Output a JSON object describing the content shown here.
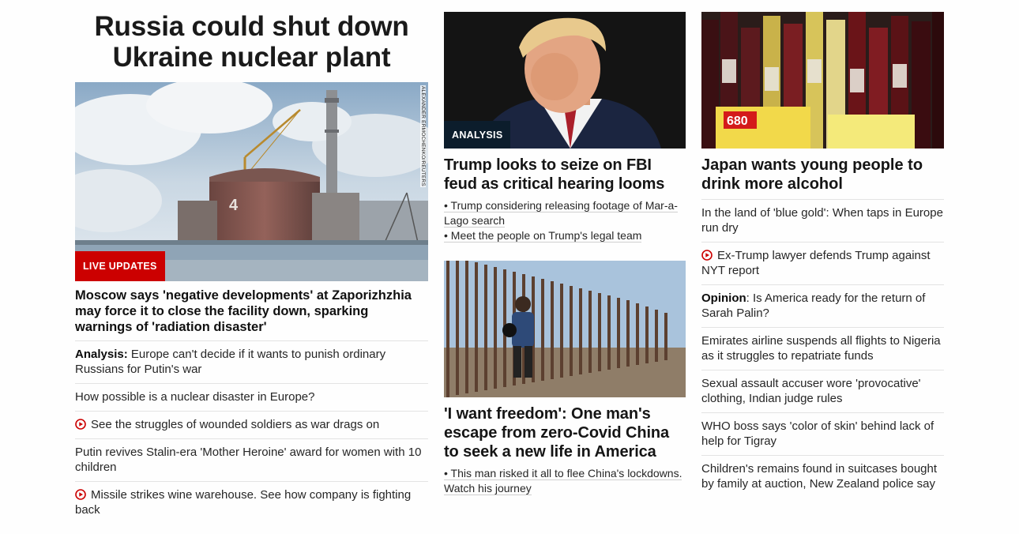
{
  "left": {
    "headline": "Russia could shut down Ukraine nuclear plant",
    "photo_credit": "ALEXANDER ERMOCHENKO/REUTERS",
    "image_label": "LIVE UPDATES",
    "summary": "Moscow says 'negative developments' at Zaporizhzhia may force it to close the facility down, sparking warnings of 'radiation disaster'",
    "items": [
      {
        "prefix": "Analysis:",
        "text": " Europe can't decide if it wants to punish ordinary Russians for Putin's war"
      },
      {
        "text": "How possible is a nuclear disaster in Europe?"
      },
      {
        "text": "See the struggles of wounded soldiers as war drags on",
        "video": true
      },
      {
        "text": "Putin revives Stalin-era 'Mother Heroine' award for women with 10 children"
      },
      {
        "text": "Missile strikes wine warehouse. See how company is fighting back",
        "video": true
      }
    ]
  },
  "mid": {
    "story1": {
      "image_label": "ANALYSIS",
      "headline": "Trump looks to seize on FBI feud as critical hearing looms",
      "bullets": [
        "Trump considering releasing footage of Mar-a-Lago search",
        "Meet the people on Trump's legal team"
      ]
    },
    "story2": {
      "headline": "'I want freedom': One man's escape from zero-Covid China to seek a new life in America",
      "bullets": [
        "This man risked it all to flee China's lockdowns. Watch his journey"
      ]
    }
  },
  "right": {
    "headline": "Japan wants young people to drink more alcohol",
    "price_tag": "680",
    "items": [
      {
        "text": "In the land of 'blue gold': When taps in Europe run dry"
      },
      {
        "text": "Ex-Trump lawyer defends Trump against NYT report",
        "video": true
      },
      {
        "prefix": "Opinion",
        "text": ": Is America ready for the return of Sarah Palin?"
      },
      {
        "text": "Emirates airline suspends all flights to Nigeria as it struggles to repatriate funds"
      },
      {
        "text": "Sexual assault accuser wore 'provocative' clothing, Indian judge rules"
      },
      {
        "text": "WHO boss says 'color of skin' behind lack of help for Tigray"
      },
      {
        "text": "Children's remains found in suitcases bought by family at auction, New Zealand police say"
      }
    ]
  },
  "colors": {
    "live": "#cc0000",
    "analysis": "#0c1d2c",
    "play": "#cc0000"
  }
}
